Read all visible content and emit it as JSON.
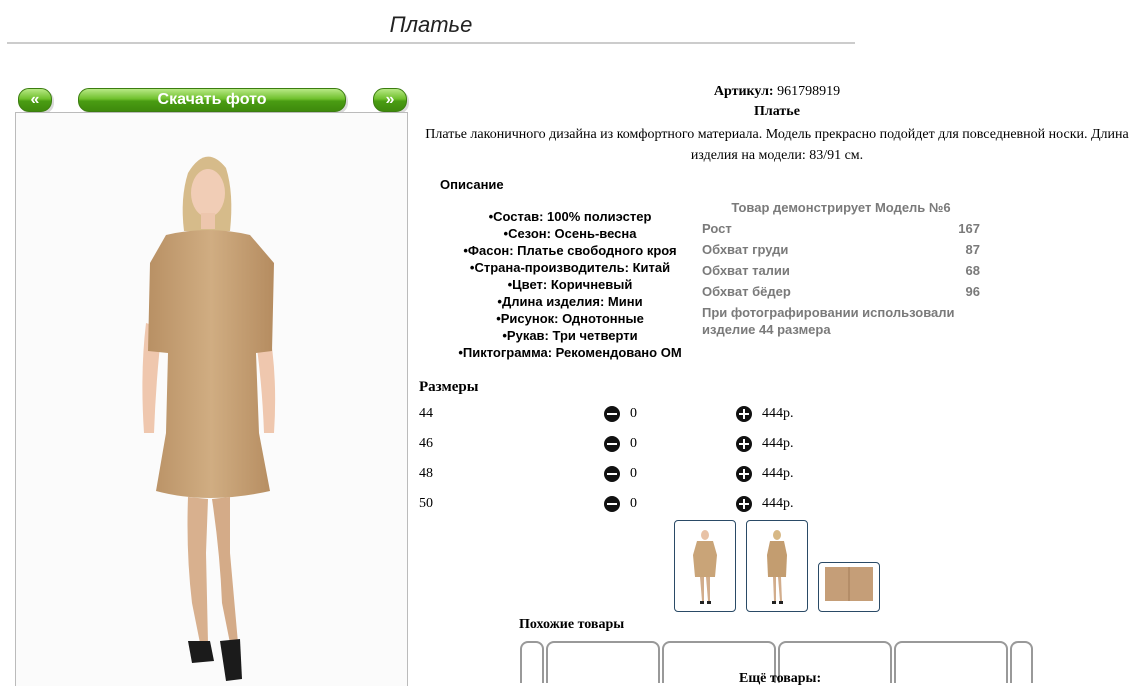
{
  "page": {
    "title": "Платье"
  },
  "nav": {
    "prev_label": "«",
    "download_label": "Скачать фото",
    "next_label": "»"
  },
  "product": {
    "article_label": "Артикул:",
    "article_value": "961798919",
    "name": "Платье",
    "description": "Платье лаконичного дизайна из комфортного материала. Модель прекрасно подойдет для повседневной носки. Длина изделия на модели: 83/91 см."
  },
  "description_section": {
    "heading": "Описание",
    "attributes": [
      "Состав: 100% полиэстер",
      "Сезон: Осень-весна",
      "Фасон: Платье свободного кроя",
      "Страна-производитель: Китай",
      "Цвет: Коричневый",
      "Длина изделия: Мини",
      "Рисунок: Однотонные",
      "Рукав: Три четверти",
      "Пиктограмма: Рекомендовано ОМ"
    ]
  },
  "model": {
    "heading": "Товар демонстрирует Модель №6",
    "rows": [
      {
        "label": "Рост",
        "value": "167"
      },
      {
        "label": "Обхват груди",
        "value": "87"
      },
      {
        "label": "Обхват талии",
        "value": "68"
      },
      {
        "label": "Обхват бёдер",
        "value": "96"
      }
    ],
    "note": "При фотографировании использовали изделие 44 размера"
  },
  "sizes": {
    "heading": "Размеры",
    "rows": [
      {
        "size": "44",
        "qty": "0",
        "price": "444р."
      },
      {
        "size": "46",
        "qty": "0",
        "price": "444р."
      },
      {
        "size": "48",
        "qty": "0",
        "price": "444р."
      },
      {
        "size": "50",
        "qty": "0",
        "price": "444р."
      }
    ]
  },
  "similar": {
    "heading": "Похожие товары"
  },
  "more": {
    "heading": "Ещё товары:"
  },
  "colors": {
    "accent_green": "#4a9c13",
    "dress": "#c9a478",
    "thumb_border": "#2a4a66",
    "muted_text": "#7a7a7a"
  }
}
